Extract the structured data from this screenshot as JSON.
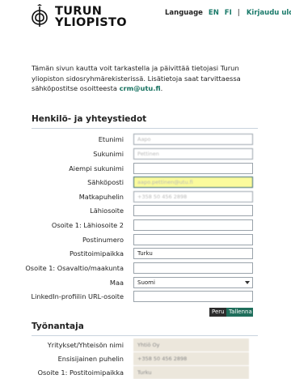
{
  "header": {
    "brand_line1": "TURUN",
    "brand_line2": "YLIOPISTO",
    "language_label": "Language",
    "lang_en": "EN",
    "lang_fi": "FI",
    "separator": "|",
    "logout": "Kirjaudu ulos"
  },
  "intro": {
    "text": "Tämän sivun kautta voit tarkastella ja päivittää tietojasi Turun yliopiston sidosryhmärekisterissä. Lisätietoja saat tarvittaessa sähköpostitse osoitteesta ",
    "email": "crm@utu.fi",
    "end": "."
  },
  "personal": {
    "title": "Henkilö- ja yhteystiedot",
    "fields": [
      {
        "label": "Etunimi",
        "value": "Aapo"
      },
      {
        "label": "Sukunimi",
        "value": "Pettinen"
      },
      {
        "label": "Aiempi sukunimi",
        "value": ""
      },
      {
        "label": "Sähköposti",
        "value": "aapo.pettinen@utu.fi"
      },
      {
        "label": "Matkapuhelin",
        "value": "+358 50 456 2898"
      },
      {
        "label": "Lähiosoite",
        "value": ""
      },
      {
        "label": "Osoite 1: Lähiosoite 2",
        "value": ""
      },
      {
        "label": "Postinumero",
        "value": ""
      },
      {
        "label": "Postitoimipaikka",
        "value": "Turku"
      },
      {
        "label": "Osoite 1: Osavaltio/maakunta",
        "value": ""
      },
      {
        "label": "Maa",
        "value": "Suomi"
      },
      {
        "label": "LinkedIn-profiilin URL-osoite",
        "value": ""
      }
    ]
  },
  "buttons": {
    "cancel": "Peru",
    "save": "Tallenna"
  },
  "employer": {
    "title": "Työnantaja",
    "fields": [
      {
        "label": "Yritykset/Yhteisön nimi",
        "value": "Yhtiö Oy"
      },
      {
        "label": "Ensisijainen puhelin",
        "value": "+358 50 456 2898"
      },
      {
        "label": "Osoite 1: Postitoimipaikka",
        "value": "Turku"
      }
    ]
  },
  "colors": {
    "accent": "#1f6e5b",
    "highlight": "#fbfb9c"
  }
}
